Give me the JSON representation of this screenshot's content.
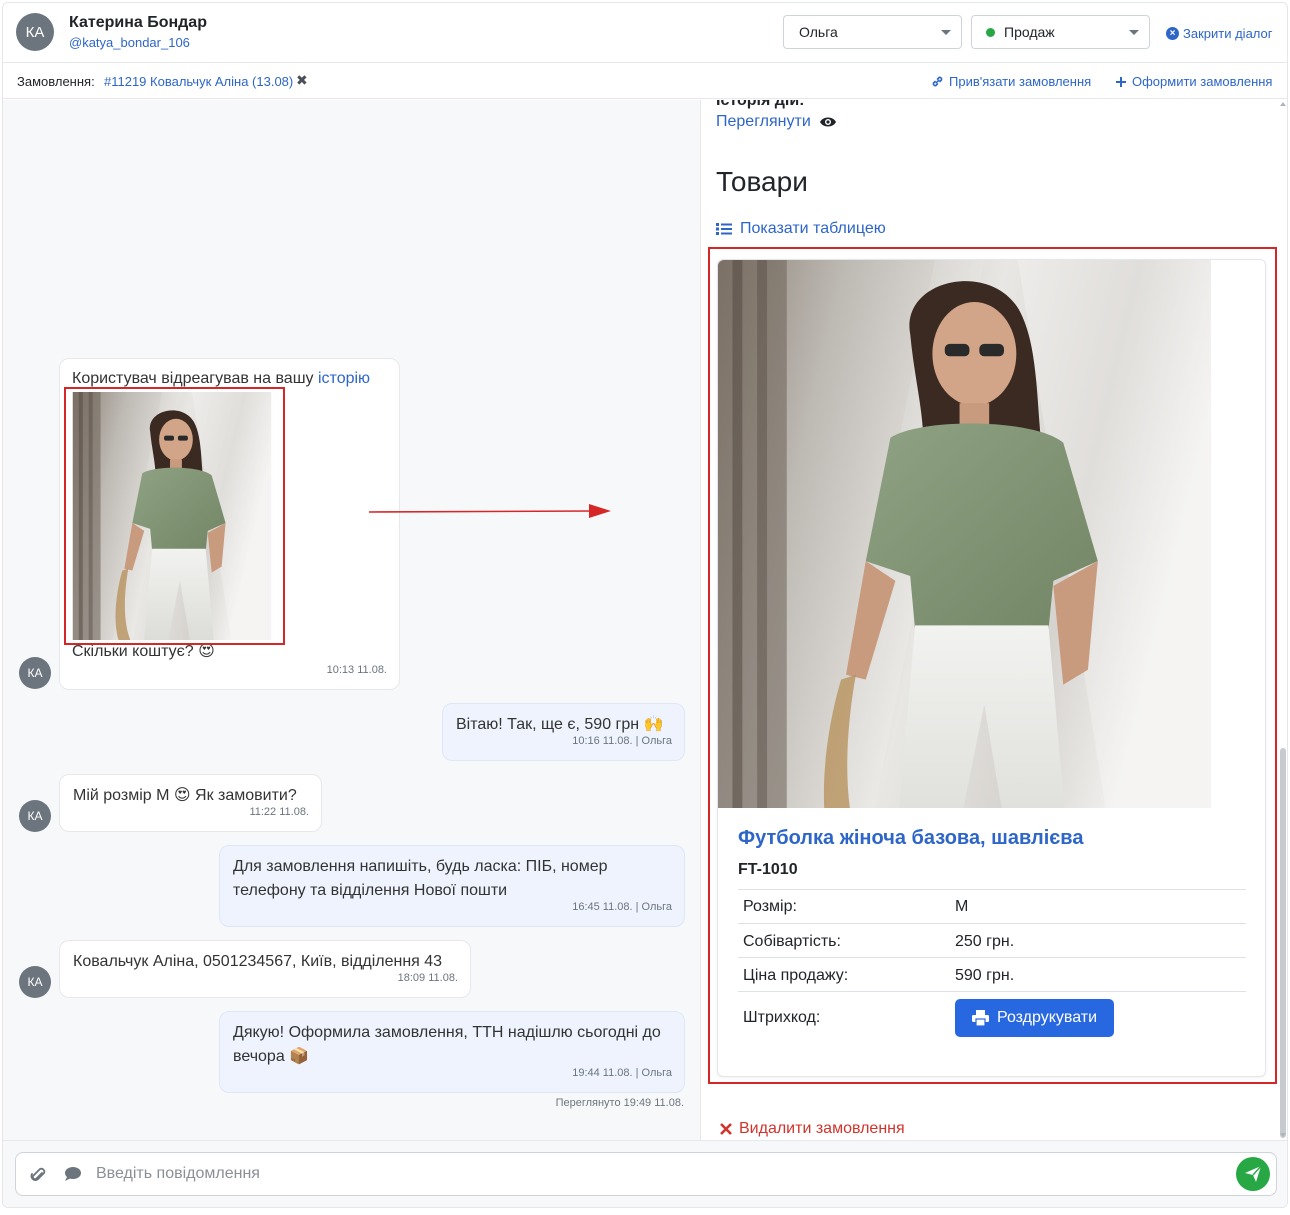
{
  "header": {
    "avatar_initials": "КА",
    "user_name": "Катерина Бондар",
    "user_handle": "@katya_bondar_106",
    "manager_select": "Ольга",
    "status_select": "Продаж",
    "close_dialog": "Закрити діалог"
  },
  "orderbar": {
    "label": "Замовлення:",
    "order": "#11219 Ковальчук Аліна (13.08)",
    "link_order": "Прив'язати замовлення",
    "create_order": "Оформити замовлення"
  },
  "chat": {
    "messages": [
      {
        "sender": "КА",
        "text_prefix": "Користувач відреагував на вашу ",
        "link": "історію",
        "text_after": "Скільки коштує? 😍",
        "meta": "10:13 11.08."
      },
      {
        "text": "Вітаю! Так, ще є, 590 грн 🙌",
        "meta": "10:16 11.08. | Ольга"
      },
      {
        "sender": "КА",
        "text": "Мій розмір М 😍 Як замовити?",
        "meta": "11:22 11.08."
      },
      {
        "text": "Для замовлення напишіть, будь ласка: ПІБ, номер телефону та відділення Нової пошти",
        "meta": "16:45 11.08. | Ольга"
      },
      {
        "sender": "КА",
        "text": "Ковальчук Аліна, 0501234567, Київ, відділення 43",
        "meta": "18:09 11.08."
      },
      {
        "text": "Дякую! Оформила замовлення, ТТН надішлю сьогодні до вечора 📦",
        "meta": "19:44 11.08. | Ольга"
      }
    ],
    "seen": "Переглянуто 19:49 11.08."
  },
  "panel": {
    "history_cut": "Історія дій:",
    "view_link": "Переглянути",
    "goods_title": "Товари",
    "show_table": "Показати таблицею",
    "product": {
      "name": "Футболка жіноча базова, шавлієва",
      "sku": "FT-1010",
      "rows": [
        {
          "k": "Розмір:",
          "v": "М"
        },
        {
          "k": "Собівартість:",
          "v": "250 грн."
        },
        {
          "k": "Ціна продажу:",
          "v": "590 грн."
        },
        {
          "k": "Штрихкод:",
          "v": ""
        }
      ],
      "print_button": "Роздрукувати"
    },
    "delete_order": "Видалити замовлення"
  },
  "composer": {
    "placeholder": "Введіть повідомлення"
  },
  "colors": {
    "accent": "#2d66c8",
    "primary_button": "#2767e0",
    "send": "#28a745",
    "danger": "#d0342c",
    "annotation": "#d62728"
  }
}
